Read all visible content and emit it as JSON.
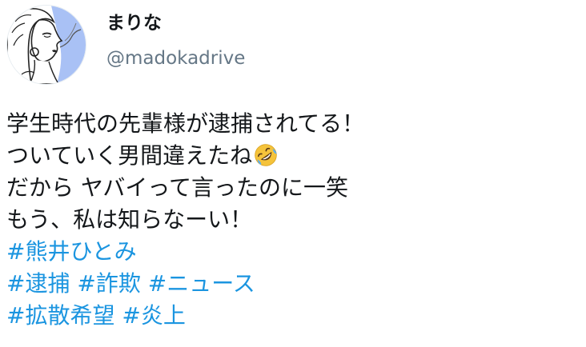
{
  "author": {
    "display_name": "まりな",
    "handle": "@madokadrive"
  },
  "tweet": {
    "lines": [
      "学生時代の先輩様が逮捕されてる！",
      "ついていく男間違えたね",
      "だから ヤバイって言ったのに一笑",
      "もう、私は知らなーい！"
    ],
    "emoji": "rolling-on-the-floor-laughing",
    "hashtags": [
      [
        "#熊井ひとみ"
      ],
      [
        "#逮捕",
        "#詐欺",
        "#ニュース"
      ],
      [
        "#拡散希望",
        "#炎上"
      ]
    ]
  },
  "colors": {
    "text": "#14171a",
    "secondary": "#657786",
    "link": "#1b95e0",
    "avatar_bg": "#a9c1f5"
  }
}
